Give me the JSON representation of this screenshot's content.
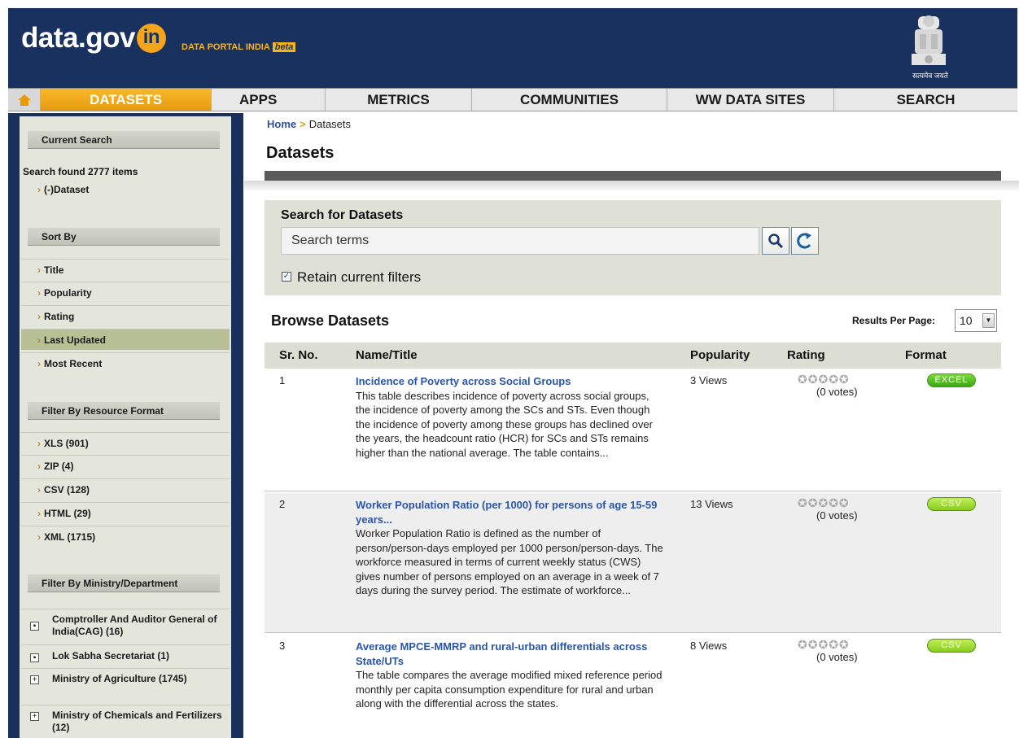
{
  "header": {
    "logo_text": "data.gov",
    "logo_badge": "in",
    "portal_name": "DATA PORTAL INDIA",
    "beta_label": "beta",
    "emblem_caption": "सत्यमेव जयते",
    "colors": {
      "brand": "#19315e",
      "accent": "#f5a51c"
    }
  },
  "nav": {
    "home_icon": "home-icon",
    "items": [
      {
        "label": "DATASETS"
      },
      {
        "label": "APPS"
      },
      {
        "label": "METRICS"
      },
      {
        "label": "COMMUNITIES"
      },
      {
        "label": "WW DATA SITES"
      },
      {
        "label": "SEARCH"
      }
    ]
  },
  "sidebar": {
    "current_search": {
      "heading": "Current Search",
      "summary": "Search found 2777 items",
      "filter": "(-)Dataset"
    },
    "sort_by": {
      "heading": "Sort By",
      "items": [
        {
          "label": "Title"
        },
        {
          "label": "Popularity"
        },
        {
          "label": "Rating"
        },
        {
          "label": "Last Updated"
        },
        {
          "label": "Most Recent"
        }
      ],
      "active": "Last Updated"
    },
    "format_filter": {
      "heading": "Filter By Resource Format",
      "items": [
        {
          "label": "XLS (901)"
        },
        {
          "label": "ZIP (4)"
        },
        {
          "label": "CSV (128)"
        },
        {
          "label": "HTML (29)"
        },
        {
          "label": "XML (1715)"
        }
      ]
    },
    "ministry_filter": {
      "heading": "Filter By Ministry/Department",
      "items": [
        {
          "label": "Comptroller And Auditor General of India(CAG) (16)",
          "toggle": "▪"
        },
        {
          "label": "Lok Sabha Secretariat (1)",
          "toggle": "▪"
        },
        {
          "label": "Ministry of Agriculture (1745)",
          "toggle": "+"
        },
        {
          "label": "Ministry of Chemicals and Fertilizers (12)",
          "toggle": "+"
        }
      ]
    }
  },
  "breadcrumb": {
    "home": "Home",
    "separator": ">",
    "current": "Datasets"
  },
  "page_title": "Datasets",
  "search": {
    "title": "Search for Datasets",
    "placeholder": "Search terms",
    "value": "",
    "retain_filters_label": "Retain current filters",
    "retain_filters_checked": true
  },
  "browse": {
    "title": "Browse Datasets",
    "results_per_page_label": "Results Per Page:",
    "results_per_page_value": "10"
  },
  "table": {
    "columns": [
      "Sr. No.",
      "Name/Title",
      "Popularity",
      "Rating",
      "Format"
    ],
    "rows": [
      {
        "num": "1",
        "title": "Incidence of Poverty across Social Groups",
        "description": "This table describes incidence of poverty across social groups, the incidence of poverty among the SCs and STs. Even though the incidence of poverty among these groups has declined over the years, the headcount ratio (HCR) for SCs and STs remains higher than the national average. The table contains...",
        "popularity": "3 Views",
        "stars": "✪✪✪✪✪",
        "rating": 0,
        "votes": "(0 votes)",
        "format": "EXCEL"
      },
      {
        "num": "2",
        "title": "Worker Population Ratio (per 1000) for persons of age 15-59 years...",
        "description": "Worker Population Ratio is defined as the number of person/person-days employed per 1000 person/person-days. The workforce measured in terms of current weekly status (CWS) gives number of persons employed on an average in a week of 7 days during the survey period. The estimate of workforce...",
        "popularity": "13 Views",
        "stars": "✪✪✪✪✪",
        "rating": 0,
        "votes": "(0 votes)",
        "format": "CSV"
      },
      {
        "num": "3",
        "title": "Average MPCE-MMRP and rural-urban differentials across State/UTs",
        "description": "The table compares the average modified mixed reference period monthly per capita consumption expenditure for rural and urban along with the differential across the states.",
        "popularity": "8 Views",
        "stars": "✪✪✪✪✪",
        "rating": 0,
        "votes": "(0 votes)",
        "format": "CSV"
      }
    ]
  }
}
